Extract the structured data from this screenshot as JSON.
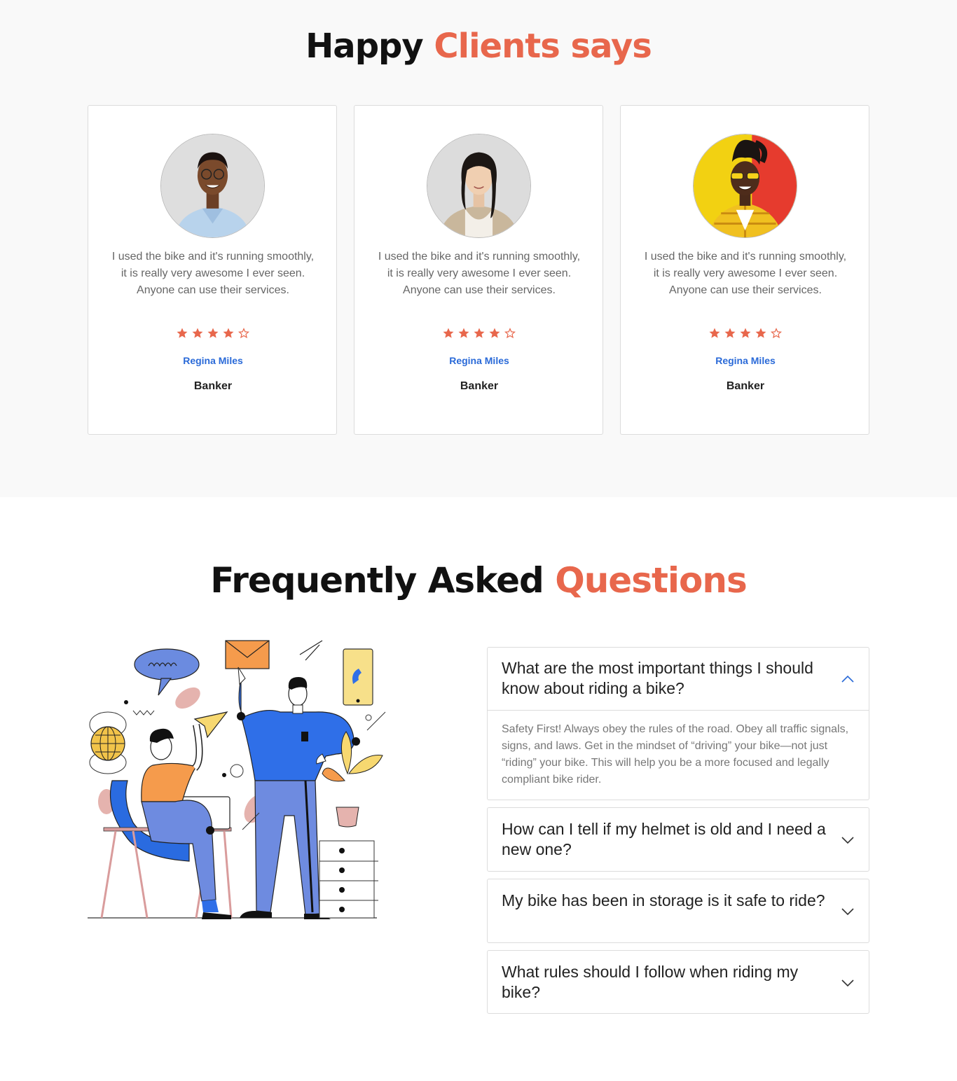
{
  "testimonials": {
    "title_part1": "Happy",
    "title_part2": "Clients says",
    "cards": [
      {
        "quote": "I used the bike and it's running smoothly, it is really very awesome I ever seen. Anyone can use their services.",
        "rating": 4,
        "rating_max": 5,
        "name": "Regina Miles",
        "role": "Banker"
      },
      {
        "quote": "I used the bike and it's running smoothly, it is really very awesome I ever seen. Anyone can use their services.",
        "rating": 4,
        "rating_max": 5,
        "name": "Regina Miles",
        "role": "Banker"
      },
      {
        "quote": "I used the bike and it's running smoothly, it is really very awesome I ever seen. Anyone can use their services.",
        "rating": 4,
        "rating_max": 5,
        "name": "Regina Miles",
        "role": "Banker"
      }
    ]
  },
  "faq": {
    "title_part1": "Frequently Asked",
    "title_part2": "Questions",
    "items": [
      {
        "question": "What are the most important things I should know about riding a bike?",
        "answer": "Safety First! Always obey the rules of the road. Obey all traffic signals, signs, and laws. Get in the mindset of “driving” your bike—not just “riding” your bike. This will help you be a more focused and legally compliant bike rider.",
        "expanded": true
      },
      {
        "question": "How can I tell if my helmet is old and I need a new one?",
        "answer": "",
        "expanded": false
      },
      {
        "question": "My bike has been in storage is it safe to ride?",
        "answer": "",
        "expanded": false
      },
      {
        "question": "What rules should I follow when riding my bike?",
        "answer": "",
        "expanded": false
      }
    ]
  },
  "colors": {
    "accent": "#e8674c",
    "name_blue": "#2a6ad8",
    "star": "#e8674c"
  },
  "icons": {
    "expanded": "chevron-up-icon",
    "collapsed": "chevron-down-icon",
    "rating": "star-icon"
  }
}
